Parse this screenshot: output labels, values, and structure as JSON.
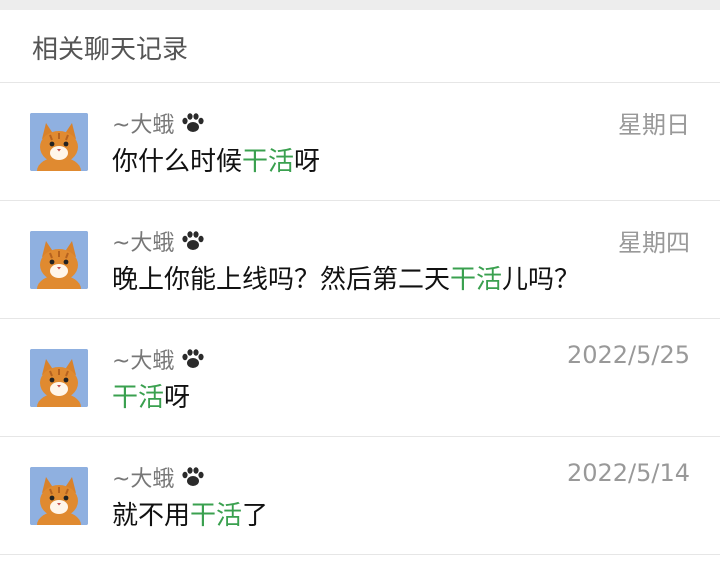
{
  "header": {
    "title": "相关聊天记录"
  },
  "colors": {
    "highlight": "#3aa04f",
    "avatar_bg": "#8fb0e0"
  },
  "results": [
    {
      "sender": "~大蛾",
      "date": "星期日",
      "before": "你什么时候",
      "keyword": "干活",
      "after": "呀",
      "avatar_icon": "cat-avatar-icon",
      "badge_icon": "paw-icon"
    },
    {
      "sender": "~大蛾",
      "date": "星期四",
      "before": "晚上你能上线吗？然后第二天",
      "keyword": "干活",
      "after": "儿吗？",
      "avatar_icon": "cat-avatar-icon",
      "badge_icon": "paw-icon"
    },
    {
      "sender": "~大蛾",
      "date": "2022/5/25",
      "before": "",
      "keyword": "干活",
      "after": "呀",
      "avatar_icon": "cat-avatar-icon",
      "badge_icon": "paw-icon"
    },
    {
      "sender": "~大蛾",
      "date": "2022/5/14",
      "before": "就不用",
      "keyword": "干活",
      "after": "了",
      "avatar_icon": "cat-avatar-icon",
      "badge_icon": "paw-icon"
    }
  ]
}
